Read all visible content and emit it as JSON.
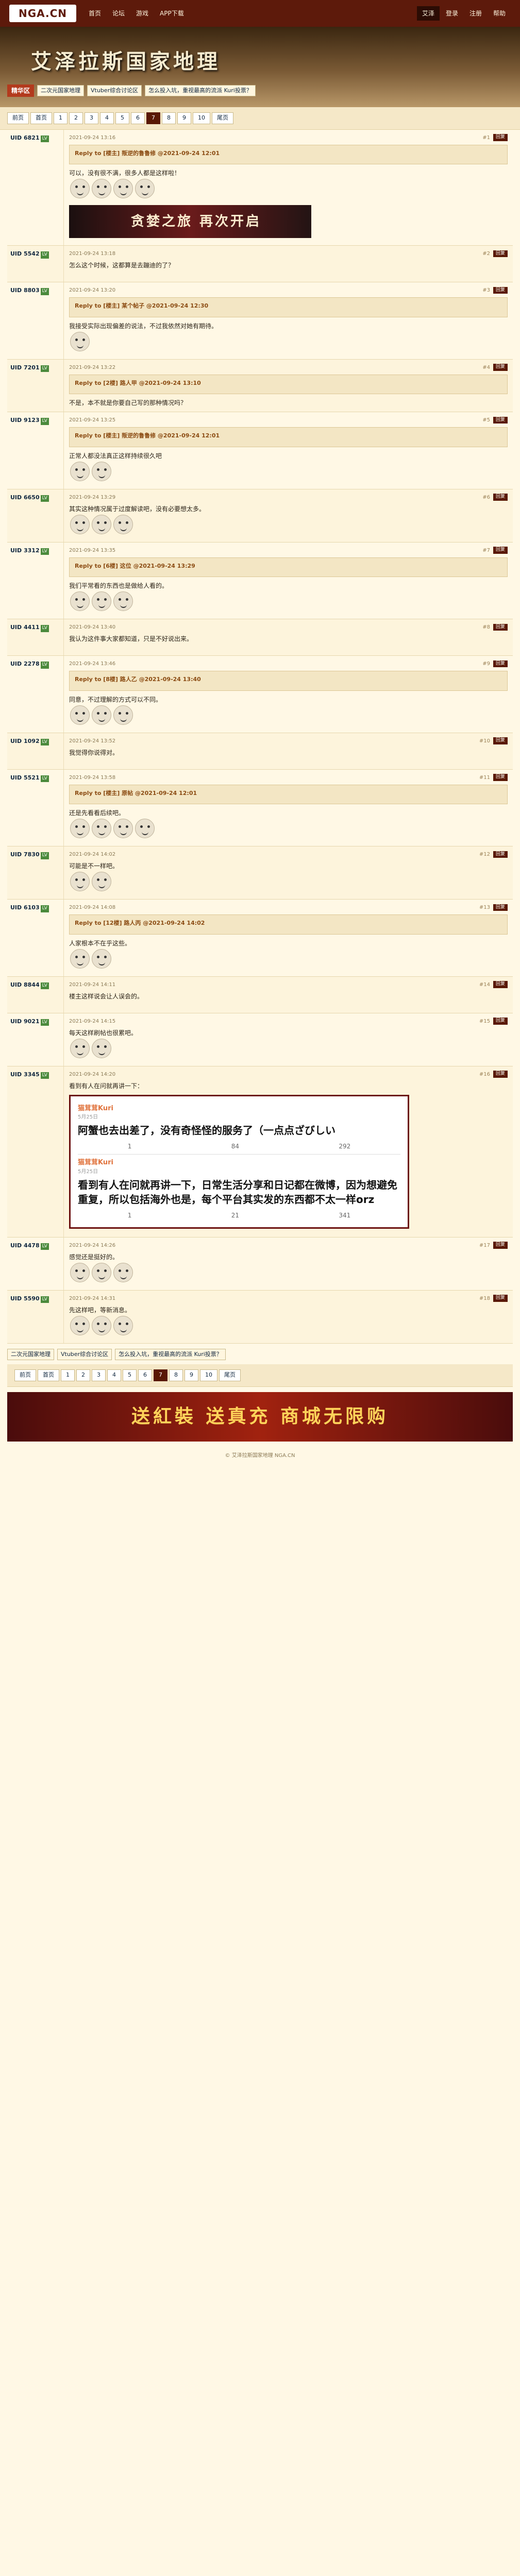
{
  "site": {
    "logo": "NGA.CN",
    "nav": [
      "首页",
      "论坛",
      "游戏",
      "APP下载"
    ],
    "right": [
      "艾泽",
      "登录",
      "注册",
      "帮助"
    ]
  },
  "banner": {
    "title": "艾泽拉斯国家地理",
    "badge": "精华区",
    "links": [
      "二次元国家地理",
      "Vtuber综合讨论区",
      "怎么投入坑，重视最高的流派 Kuri投票？"
    ]
  },
  "pager": [
    "前页",
    "首页",
    "1",
    "2",
    "3",
    "4",
    "5",
    "6",
    "7",
    "8",
    "9",
    "10",
    "尾页"
  ],
  "posts": [
    {
      "user": "UID 6821",
      "floor": "#1",
      "time": "2021-09-24 13:16",
      "quote": "Reply to [楼主] 叛逆的鲁鲁修 @2021-09-24 12:01",
      "text": "可以，没有很不满，很多人都是这样啦！",
      "emos": 4,
      "game": "贪婪之旅 再次开启"
    },
    {
      "user": "UID 5542",
      "floor": "#2",
      "time": "2021-09-24 13:18",
      "text": "怎么这个时候，这都算是去蹦迪的了？",
      "emos": 0
    },
    {
      "user": "UID 8803",
      "floor": "#3",
      "time": "2021-09-24 13:20",
      "quote": "Reply to [楼主] 某个帖子 @2021-09-24 12:30",
      "text": "我接受实际出现偏差的说法，不过我依然对她有期待。",
      "emos": 1
    },
    {
      "user": "UID 7201",
      "floor": "#4",
      "time": "2021-09-24 13:22",
      "quote": "Reply to [2楼] 路人甲 @2021-09-24 13:10",
      "text": "不是，本不就是你要自己写的那种情况吗？",
      "emos": 0
    },
    {
      "user": "UID 9123",
      "floor": "#5",
      "time": "2021-09-24 13:25",
      "quote": "Reply to [楼主] 叛逆的鲁鲁修 @2021-09-24 12:01",
      "text": "正常人都没法真正这样持续很久吧",
      "emos": 2
    },
    {
      "user": "UID 6650",
      "floor": "#6",
      "time": "2021-09-24 13:29",
      "text": "其实这种情况属于过度解读吧，没有必要想太多。",
      "emos": 3
    },
    {
      "user": "UID 3312",
      "floor": "#7",
      "time": "2021-09-24 13:35",
      "quote": "Reply to [6楼] 这位 @2021-09-24 13:29",
      "text": "我们平常看的东西也是做给人看的。",
      "emos": 3
    },
    {
      "user": "UID 4411",
      "floor": "#8",
      "time": "2021-09-24 13:40",
      "text": "我认为这件事大家都知道，只是不好说出来。",
      "emos": 0
    },
    {
      "user": "UID 2278",
      "floor": "#9",
      "time": "2021-09-24 13:46",
      "quote": "Reply to [8楼] 路人乙 @2021-09-24 13:40",
      "text": "同意，不过理解的方式可以不同。",
      "emos": 3
    },
    {
      "user": "UID 1092",
      "floor": "#10",
      "time": "2021-09-24 13:52",
      "text": "我觉得你说得对。",
      "emos": 0
    },
    {
      "user": "UID 5521",
      "floor": "#11",
      "time": "2021-09-24 13:58",
      "quote": "Reply to [楼主] 原帖 @2021-09-24 12:01",
      "text": "还是先看看后续吧。",
      "emos": 4
    },
    {
      "user": "UID 7830",
      "floor": "#12",
      "time": "2021-09-24 14:02",
      "text": "可能是不一样吧。",
      "emos": 2
    },
    {
      "user": "UID 6103",
      "floor": "#13",
      "time": "2021-09-24 14:08",
      "quote": "Reply to [12楼] 路人丙 @2021-09-24 14:02",
      "text": "人家根本不在乎这些。",
      "emos": 2
    },
    {
      "user": "UID 8844",
      "floor": "#14",
      "time": "2021-09-24 14:11",
      "text": "楼主这样说会让人误会的。",
      "emos": 0
    },
    {
      "user": "UID 9021",
      "floor": "#15",
      "time": "2021-09-24 14:15",
      "text": "每天这样刷帖也很累吧。",
      "emos": 2
    },
    {
      "user": "UID 3345",
      "floor": "#16",
      "time": "2021-09-24 14:20",
      "text": "看到有人在问就再讲一下：",
      "emos": 0
    },
    {
      "user": "UID 4478",
      "floor": "#17",
      "time": "2021-09-24 14:26",
      "text": "感觉还是挺好的。",
      "emos": 3
    },
    {
      "user": "UID 5590",
      "floor": "#18",
      "time": "2021-09-24 14:31",
      "text": "先这样吧，等新消息。",
      "emos": 3
    }
  ],
  "weibo": [
    {
      "name": "猫茸茸Kuri",
      "time": "5月25日",
      "text": "阿蟹也去出差了，没有奇怪怪的服务了（一点点ざびしい",
      "c1": "1",
      "c2": "84",
      "c3": "292"
    },
    {
      "name": "猫茸茸Kuri",
      "time": "5月25日",
      "text": "看到有人在问就再讲一下，日常生活分享和日记都在微博，因为想避免重复，所以包括海外也是，每个平台其实发的东西都不太一样orz",
      "c1": "1",
      "c2": "21",
      "c3": "341"
    }
  ],
  "footer": {
    "links": [
      "二次元国家地理",
      "Vtuber综合讨论区",
      "怎么投入坑，重视最高的流派 Kuri投票？"
    ],
    "ad": "送紅裝 送真充 商城无限购",
    "copyright": "© 艾泽拉斯国家地理 NGA.CN"
  }
}
